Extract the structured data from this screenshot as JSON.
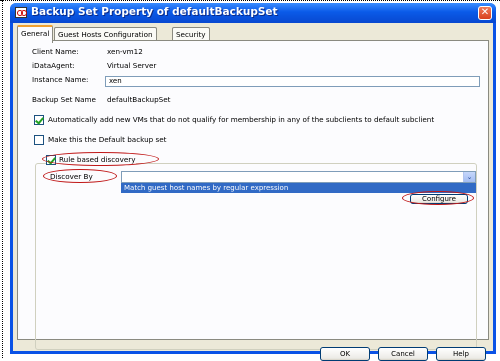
{
  "window": {
    "title": "Backup Set Property of defaultBackupSet",
    "close_symbol": "✕"
  },
  "tabs": [
    {
      "label": "General",
      "active": true
    },
    {
      "label": "Guest Hosts Configuration",
      "active": false
    },
    {
      "label": "Security",
      "active": false
    }
  ],
  "general": {
    "client_name_label": "Client Name:",
    "client_name_value": "xen-vm12",
    "idataagent_label": "iDataAgent:",
    "idataagent_value": "Virtual Server",
    "instance_name_label": "Instance Name:",
    "instance_name_value": "xen",
    "backup_set_name_label": "Backup Set Name",
    "backup_set_name_value": "defaultBackupSet",
    "auto_add_vms_label": "Automatically add new VMs that do not qualify for membership in any of the subclients to default subclient",
    "auto_add_vms_checked": true,
    "default_backup_set_label": "Make this the Default backup set",
    "default_backup_set_checked": false,
    "rule_based_discovery_label": "Rule based discovery",
    "rule_based_discovery_checked": true,
    "discover_by_label": "Discover By",
    "discover_by_value": "",
    "discover_by_option": "Match guest host names by regular expression",
    "configure_label": "Configure"
  },
  "footer": {
    "ok_label": "OK",
    "cancel_label": "Cancel",
    "help_label": "Help"
  },
  "colors": {
    "titlebar": "#0a5ae8",
    "dialog_bg": "#ece9d8",
    "selection": "#316ac5",
    "annotation": "#c01818"
  }
}
